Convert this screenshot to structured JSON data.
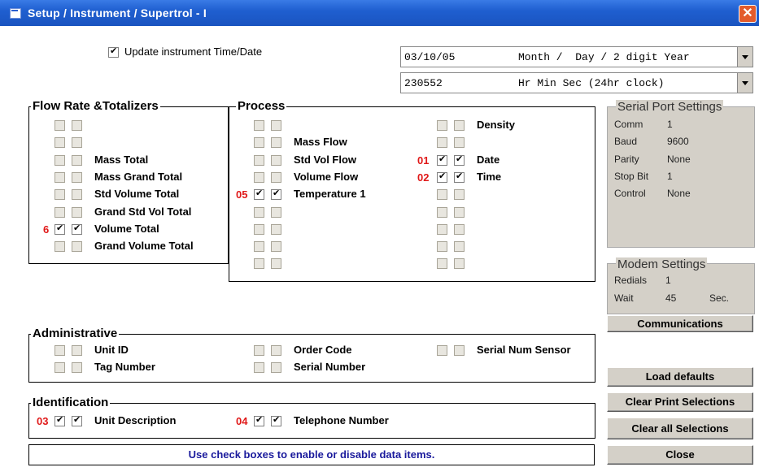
{
  "window": {
    "title": "Setup / Instrument / Supertrol - I",
    "close_glyph": "✕"
  },
  "update_time": {
    "label": "Update instrument Time/Date",
    "checked": true
  },
  "date_dropdown": {
    "value": "03/10/05",
    "format": "Month /  Day / 2 digit Year"
  },
  "time_dropdown": {
    "value": "230552",
    "format": "Hr Min Sec (24hr clock)"
  },
  "flow": {
    "title": "Flow Rate &Totalizers",
    "items": [
      {
        "label": "",
        "marker": "",
        "checked": false
      },
      {
        "label": "",
        "marker": "",
        "checked": false
      },
      {
        "label": "Mass Total",
        "marker": "",
        "checked": false
      },
      {
        "label": "Mass Grand Total",
        "marker": "",
        "checked": false
      },
      {
        "label": "Std Volume Total",
        "marker": "",
        "checked": false
      },
      {
        "label": "Grand Std Vol Total",
        "marker": "",
        "checked": false
      },
      {
        "label": "Volume Total",
        "marker": "6",
        "checked": true
      },
      {
        "label": "Grand Volume Total",
        "marker": "",
        "checked": false
      }
    ]
  },
  "process": {
    "title": "Process",
    "col1": [
      {
        "label": "",
        "marker": "",
        "checked": false
      },
      {
        "label": "Mass Flow",
        "marker": "",
        "checked": false
      },
      {
        "label": "Std Vol Flow",
        "marker": "",
        "checked": false
      },
      {
        "label": "Volume Flow",
        "marker": "",
        "checked": false
      },
      {
        "label": "Temperature 1",
        "marker": "05",
        "checked": true
      },
      {
        "label": "",
        "marker": "",
        "checked": false
      },
      {
        "label": "",
        "marker": "",
        "checked": false
      },
      {
        "label": "",
        "marker": "",
        "checked": false
      },
      {
        "label": "",
        "marker": "",
        "checked": false
      }
    ],
    "col2": [
      {
        "label": "Density",
        "marker": "",
        "checked": false
      },
      {
        "label": "",
        "marker": "",
        "checked": false
      },
      {
        "label": "Date",
        "marker": "01",
        "checked": true
      },
      {
        "label": "Time",
        "marker": "02",
        "checked": true
      },
      {
        "label": "",
        "marker": "",
        "checked": false
      },
      {
        "label": "",
        "marker": "",
        "checked": false
      },
      {
        "label": "",
        "marker": "",
        "checked": false
      },
      {
        "label": "",
        "marker": "",
        "checked": false
      },
      {
        "label": "",
        "marker": "",
        "checked": false
      }
    ]
  },
  "serial": {
    "title": "Serial Port Settings",
    "rows": [
      {
        "key": "Comm",
        "value": "1"
      },
      {
        "key": "Baud",
        "value": "9600"
      },
      {
        "key": "Parity",
        "value": "None"
      },
      {
        "key": "Stop Bit",
        "value": "1"
      },
      {
        "key": "Control",
        "value": "None"
      }
    ]
  },
  "modem": {
    "title": "Modem Settings",
    "redials_label": "Redials",
    "redials_value": "1",
    "wait_label": "Wait",
    "wait_value": "45",
    "wait_unit": "Sec."
  },
  "buttons": {
    "communications": "Communications",
    "load_defaults": "Load defaults",
    "clear_print": "Clear Print Selections",
    "clear_all": "Clear all Selections",
    "close": "Close"
  },
  "admin": {
    "title": "Administrative",
    "items": [
      {
        "label": "Unit ID",
        "marker": "",
        "checked": false
      },
      {
        "label": "Tag Number",
        "marker": "",
        "checked": false
      },
      {
        "label": "Order Code",
        "marker": "",
        "checked": false
      },
      {
        "label": "Serial Number",
        "marker": "",
        "checked": false
      },
      {
        "label": "Serial Num Sensor",
        "marker": "",
        "checked": false
      }
    ]
  },
  "ident": {
    "title": "Identification",
    "items": [
      {
        "label": "Unit Description",
        "marker": "03",
        "checked": true
      },
      {
        "label": "Telephone Number",
        "marker": "04",
        "checked": true
      }
    ]
  },
  "status": "Use check boxes to enable or disable data items."
}
